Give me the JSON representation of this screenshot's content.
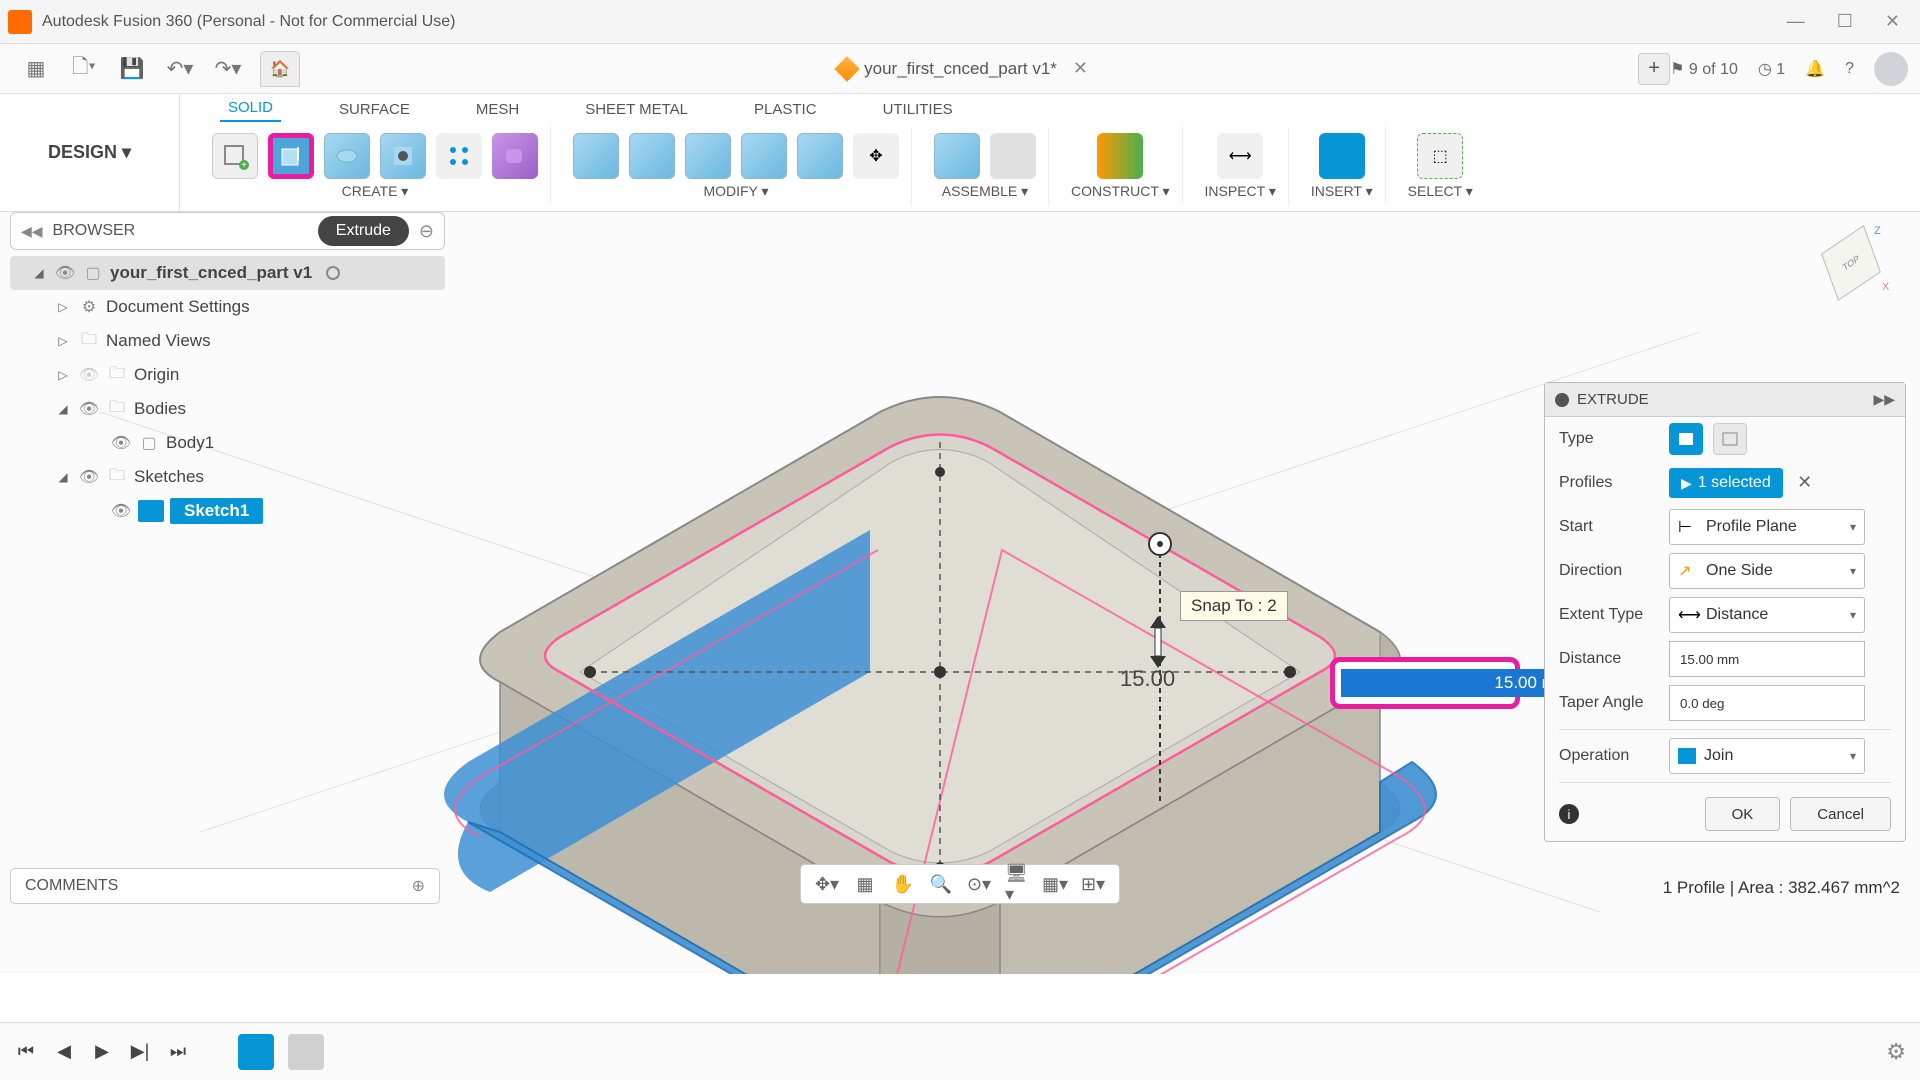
{
  "window": {
    "title": "Autodesk Fusion 360 (Personal - Not for Commercial Use)"
  },
  "quickbar": {
    "doc_name": "your_first_cnced_part v1*",
    "ext_count": "9 of 10",
    "job_count": "1"
  },
  "ribbon": {
    "design_label": "DESIGN ▾",
    "tabs": {
      "solid": "SOLID",
      "surface": "SURFACE",
      "mesh": "MESH",
      "sheet_metal": "SHEET METAL",
      "plastic": "PLASTIC",
      "utilities": "UTILITIES"
    },
    "groups": {
      "create": "CREATE ▾",
      "modify": "MODIFY ▾",
      "assemble": "ASSEMBLE ▾",
      "construct": "CONSTRUCT ▾",
      "inspect": "INSPECT ▾",
      "insert": "INSERT ▾",
      "select": "SELECT ▾"
    }
  },
  "browser": {
    "title": "BROWSER",
    "tooltip": "Extrude",
    "root": "your_first_cnced_part v1",
    "items": {
      "doc_settings": "Document Settings",
      "named_views": "Named Views",
      "origin": "Origin",
      "bodies": "Bodies",
      "body1": "Body1",
      "sketches": "Sketches",
      "sketch1": "Sketch1"
    }
  },
  "canvas": {
    "snap_tooltip": "Snap To : 2",
    "dim_label": "15.00",
    "dim_input": "15.00 mm"
  },
  "extrude": {
    "title": "EXTRUDE",
    "rows": {
      "type": "Type",
      "profiles": "Profiles",
      "profiles_value": "1 selected",
      "start": "Start",
      "start_value": "Profile Plane",
      "direction": "Direction",
      "direction_value": "One Side",
      "extent": "Extent Type",
      "extent_value": "Distance",
      "distance": "Distance",
      "distance_value": "15.00 mm",
      "taper": "Taper Angle",
      "taper_value": "0.0 deg",
      "operation": "Operation",
      "operation_value": "Join"
    },
    "ok": "OK",
    "cancel": "Cancel"
  },
  "comments": {
    "title": "COMMENTS"
  },
  "status": {
    "text": "1 Profile | Area : 382.467 mm^2"
  }
}
